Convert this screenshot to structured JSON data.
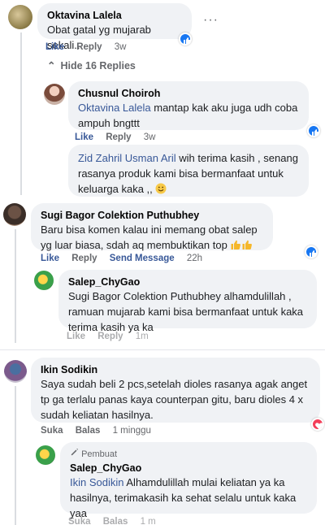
{
  "comments": [
    {
      "name": "Oktavina Lalela",
      "text": "Obat gatal yg mujarab sekali..",
      "like": "Like",
      "reply": "Reply",
      "time": "3w"
    },
    {
      "name": "Chusnul Choiroh",
      "mention": "Oktavina Lalela",
      "text": " mantap kak aku juga udh coba ampuh bngttt",
      "like": "Like",
      "reply": "Reply",
      "time": "3w"
    },
    {
      "mention": "Zid Zahril Usman Aril",
      "text": " wih terima kasih , senang rasanya produk kami bisa bermanfaat untuk keluarga kaka ,,"
    },
    {
      "name": "Sugi Bagor Colektion Puthubhey",
      "text": "Baru bisa komen kalau ini memang obat salep yg luar biasa, sdah aq membuktikan top",
      "like": "Like",
      "reply": "Reply",
      "send": "Send Message",
      "time": "22h"
    },
    {
      "name": "Salep_ChyGao",
      "mention": "Sugi Bagor Colektion Puthubhey",
      "text": " alhamdulillah , ramuan mujarab kami bisa bermanfaat untuk kaka terima kasih ya ka",
      "like": "Like",
      "reply": "Reply",
      "time": "1m"
    },
    {
      "name": "Ikin Sodikin",
      "text": "Saya sudah beli 2 pcs,setelah dioles rasanya agak anget tp ga terlalu panas kaya counterpan gitu, baru dioles 4 x sudah keliatan hasilnya.",
      "like": "Suka",
      "reply": "Balas",
      "time": "1 minggu"
    },
    {
      "badge": "Pembuat",
      "name": "Salep_ChyGao",
      "mention": "Ikin Sodikin",
      "text": " Alhamdulillah mulai keliatan ya ka hasilnya, terimakasih ka sehat selalu untuk kaka yaa",
      "like": "Suka",
      "reply": "Balas",
      "time": "1 m"
    }
  ],
  "hide_replies": "Hide 16 Replies",
  "colors": {
    "bubble": "#f0f2f5",
    "link": "#385898",
    "like_reaction": "#1877f2",
    "love_reaction": "#f33e58"
  },
  "icons": [
    "like-reaction-icon",
    "love-reaction-icon",
    "thumbs-up-emoji",
    "smile-emoji",
    "pencil-icon",
    "chevron-up-icon",
    "more-dots-icon"
  ]
}
